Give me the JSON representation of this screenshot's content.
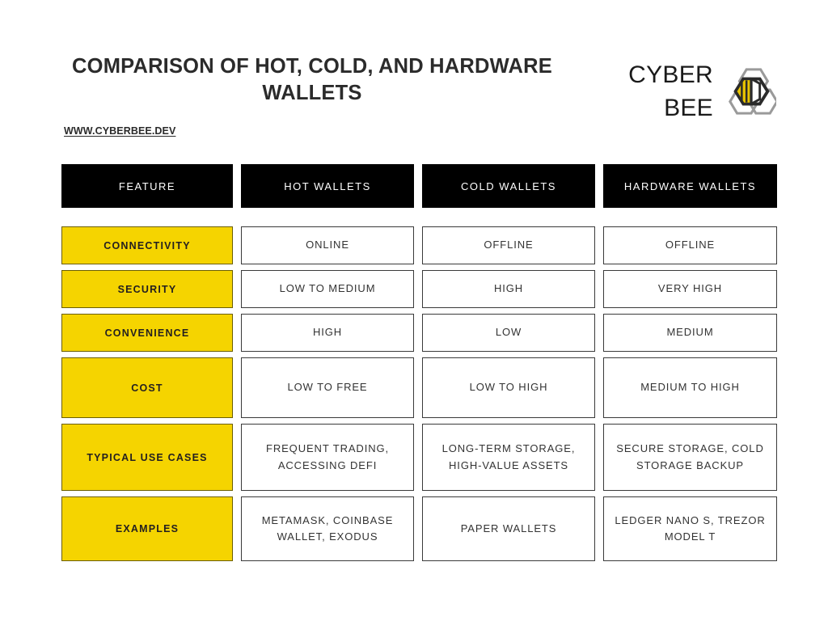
{
  "header": {
    "title": "COMPARISON OF HOT, COLD, AND HARDWARE WALLETS",
    "url": "WWW.CYBERBEE.DEV",
    "brand_name": "CYBER\nBEE",
    "logo_icon": "hexagon-bee-logo-icon"
  },
  "colors": {
    "accent_yellow": "#F5D400",
    "header_black": "#000000",
    "text_dark": "#231F20",
    "cell_border": "#3A3A3A",
    "label_border": "#6B5E00",
    "logo_gray": "#9A9A9A",
    "logo_dark": "#2B2B2B"
  },
  "table": {
    "columns": [
      {
        "label": "FEATURE"
      },
      {
        "label": "HOT WALLETS"
      },
      {
        "label": "COLD WALLETS"
      },
      {
        "label": "HARDWARE WALLETS"
      }
    ],
    "rows": [
      {
        "label": "CONNECTIVITY",
        "hot": "ONLINE",
        "cold": "OFFLINE",
        "hardware": "OFFLINE"
      },
      {
        "label": "SECURITY",
        "hot": "LOW TO MEDIUM",
        "cold": "HIGH",
        "hardware": "VERY HIGH"
      },
      {
        "label": "CONVENIENCE",
        "hot": "HIGH",
        "cold": "LOW",
        "hardware": "MEDIUM"
      },
      {
        "label": "COST",
        "hot": "LOW TO FREE",
        "cold": "LOW TO HIGH",
        "hardware": "MEDIUM TO HIGH"
      },
      {
        "label": "TYPICAL USE CASES",
        "hot": "FREQUENT TRADING, ACCESSING DEFI",
        "cold": "LONG-TERM STORAGE, HIGH-VALUE ASSETS",
        "hardware": "SECURE STORAGE, COLD STORAGE BACKUP"
      },
      {
        "label": "EXAMPLES",
        "hot": "METAMASK, COINBASE WALLET, EXODUS",
        "cold": "PAPER WALLETS",
        "hardware": "LEDGER NANO S, TREZOR MODEL T"
      }
    ]
  }
}
